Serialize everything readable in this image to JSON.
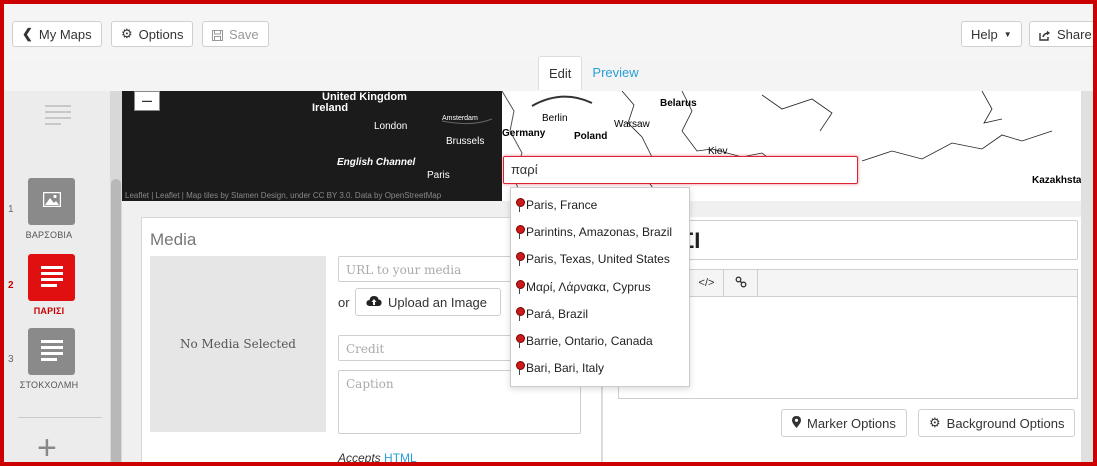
{
  "toolbar": {
    "my_maps": "My Maps",
    "options": "Options",
    "save": "Save",
    "help": "Help",
    "share": "Share"
  },
  "tabs": {
    "edit": "Edit",
    "preview": "Preview"
  },
  "slides": [
    {
      "num": "1",
      "label": "ΒΑΡΣΟΒΙΑ",
      "type": "image"
    },
    {
      "num": "2",
      "label": "ΠΑΡΙΣΙ",
      "type": "text",
      "active": true
    },
    {
      "num": "3",
      "label": "ΣΤΟΚΧΟΛΜΗ",
      "type": "text"
    }
  ],
  "map": {
    "labels": {
      "united_kingdom": "United Kingdom",
      "ireland": "Ireland",
      "london": "London",
      "amsterdam": "Amsterdam",
      "berlin": "Berlin",
      "germany": "Germany",
      "brussels": "Brussels",
      "warsaw": "Warsaw",
      "poland": "Poland",
      "belarus": "Belarus",
      "kiev": "Kiev",
      "english_channel": "English Channel",
      "paris": "Paris",
      "kazakhstan": "Kazakhstan"
    },
    "attribution": "Leaflet | Leaflet | Map tiles by Stamen Design, under CC BY 3.0. Data by OpenStreetMap",
    "zoom_out": "–"
  },
  "search": {
    "value": "παρί",
    "results": [
      "Paris, France",
      "Parintins, Amazonas, Brazil",
      "Paris, Texas, United States",
      "Μαρί, Λάρνακα, Cyprus",
      "Pará, Brazil",
      "Barrie, Ontario, Canada",
      "Bari, Bari, Italy"
    ]
  },
  "media": {
    "title": "Media",
    "no_media": "No Media Selected",
    "url_placeholder": "URL to your media",
    "or": "or",
    "upload": "Upload an Image",
    "credit_placeholder": "Credit",
    "caption_placeholder": "Caption",
    "accepts": "Accepts",
    "accepts_link": "HTML"
  },
  "text": {
    "headline_visible": "ΣΙ",
    "code_toggle": "</>",
    "link_icon": "link-icon"
  },
  "buttons": {
    "marker_options": "Marker Options",
    "background_options": "Background Options"
  },
  "colors": {
    "accent": "#cc0000",
    "link": "#29a0d8"
  }
}
